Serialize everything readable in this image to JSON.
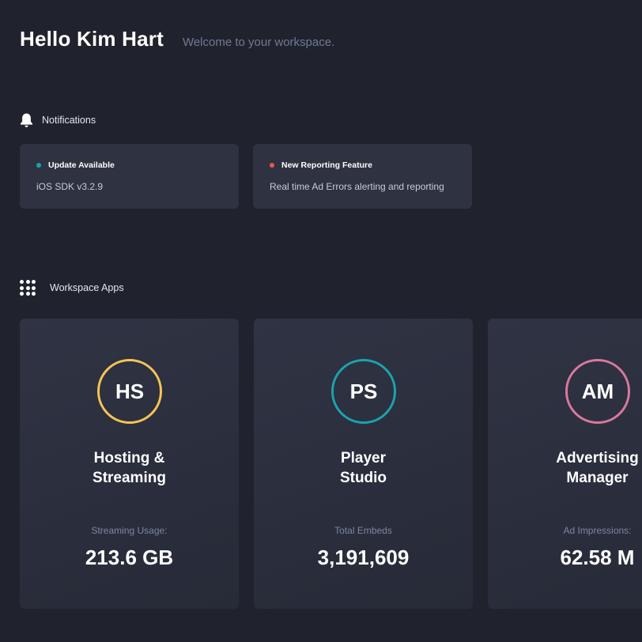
{
  "header": {
    "greeting": "Hello Kim Hart",
    "welcome": "Welcome to your workspace."
  },
  "notifications": {
    "title": "Notifications",
    "icon": "bell-icon",
    "items": [
      {
        "title": "Update Available",
        "body": "iOS SDK v3.2.9",
        "dot_color": "#1aa3ad"
      },
      {
        "title": "New Reporting Feature",
        "body": "Real time Ad Errors alerting and reporting",
        "dot_color": "#e8594f"
      }
    ]
  },
  "apps": {
    "title": "Workspace Apps",
    "icon": "grid-icon",
    "items": [
      {
        "initials": "HS",
        "name": "Hosting &\nStreaming",
        "metric_label": "Streaming Usage:",
        "metric_value": "213.6 GB",
        "ring_color": "#f5c453"
      },
      {
        "initials": "PS",
        "name": "Player\nStudio",
        "metric_label": "Total Embeds",
        "metric_value": "3,191,609",
        "ring_color": "#1aa3ad"
      },
      {
        "initials": "AM",
        "name": "Advertising\nManager",
        "metric_label": "Ad Impressions:",
        "metric_value": "62.58 M",
        "ring_color": "#d9789e"
      }
    ]
  },
  "colors": {
    "background": "#20232d",
    "card": "#2e3241",
    "muted_text": "#6f7a95"
  }
}
